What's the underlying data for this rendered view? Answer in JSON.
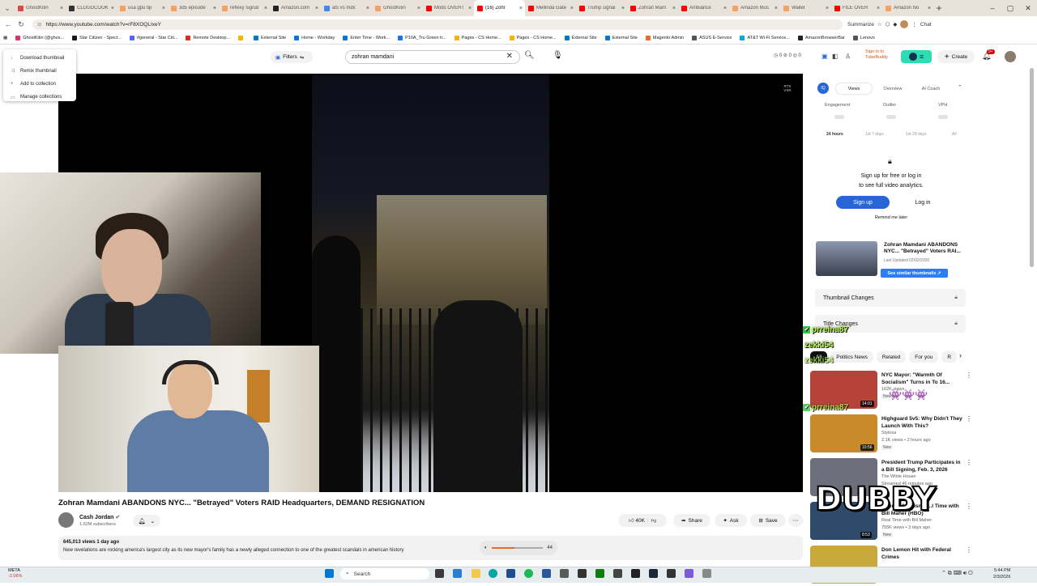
{
  "browser": {
    "tabs": [
      {
        "label": "GhostKitin",
        "color": "#d84a4a"
      },
      {
        "label": "CLOUDCOOK",
        "color": "#333333"
      },
      {
        "label": "usa gpu tip",
        "color": "#f4a261"
      },
      {
        "label": "3d5 episode",
        "color": "#f4a261"
      },
      {
        "label": "reflexy signal",
        "color": "#f4a261"
      },
      {
        "label": "Amazon.com",
        "color": "#222222"
      },
      {
        "label": "ats vs mdx",
        "color": "#4285f4"
      },
      {
        "label": "GhostKitin",
        "color": "#f4a261"
      },
      {
        "label": "Mobs OVERT",
        "color": "#ff0000"
      },
      {
        "label": "(16) Zohr",
        "color": "#ff0000"
      },
      {
        "label": "Mellinda Gate",
        "color": "#ff0000"
      },
      {
        "label": "Trump signal",
        "color": "#ff0000"
      },
      {
        "label": "Zohran Mam",
        "color": "#ff0000"
      },
      {
        "label": "Ambiance",
        "color": "#ff0000"
      },
      {
        "label": "Amazon Mus",
        "color": "#f4a261"
      },
      {
        "label": "Wallet",
        "color": "#f4a261"
      },
      {
        "label": "FILE OVER",
        "color": "#ff0000"
      },
      {
        "label": "Amazon No",
        "color": "#f4a261"
      }
    ],
    "active_tab_index": 9,
    "new_tab": "+",
    "url": "https://www.youtube.com/watch?v=rF8XOQLIxeY",
    "summarize": "Summarize",
    "chat_label": "Chat",
    "bookmarks": [
      {
        "label": "GhostKitin (@ghos...",
        "color": "#e1306c"
      },
      {
        "label": "Star Citizen - Spect...",
        "color": "#1a1a1a"
      },
      {
        "label": "#general - Star Citi...",
        "color": "#5865f2"
      },
      {
        "label": "Remote Desktop...",
        "color": "#d93025"
      },
      {
        "label": "",
        "color": "#f4b400"
      },
      {
        "label": "External Site",
        "color": "#0078d4"
      },
      {
        "label": "Home - Workday",
        "color": "#0875e1"
      },
      {
        "label": "Enter Time - Work...",
        "color": "#0875e1"
      },
      {
        "label": "P10A_Tru Green tr...",
        "color": "#1a73e8"
      },
      {
        "label": "Pages - CS Home...",
        "color": "#f4b400"
      },
      {
        "label": "Pages - CS Home...",
        "color": "#f4b400"
      },
      {
        "label": "External Site",
        "color": "#0078d4"
      },
      {
        "label": "External Site",
        "color": "#0078d4"
      },
      {
        "label": "Magento Admin",
        "color": "#ee672f"
      },
      {
        "label": "ASUS E-Service",
        "color": "#555555"
      },
      {
        "label": "AT&T Wi-Fi Service...",
        "color": "#00a8e0"
      },
      {
        "label": "AmazonBrowserBar",
        "color": "#222222"
      },
      {
        "label": "Lenovo",
        "color": "#555555"
      }
    ]
  },
  "context_menu": {
    "items": [
      {
        "label": "Download thumbnail",
        "icon": "↓"
      },
      {
        "label": "Remix thumbnail",
        "icon": "⤨"
      },
      {
        "label": "Add to collection",
        "icon": "+"
      },
      {
        "label": "Manage collections",
        "icon": "▭"
      }
    ]
  },
  "youtube": {
    "filters_label": "Filters",
    "search_value": "zohran mamdani",
    "header_counts": "◷ 0  ⊘ 0  ◎ 0",
    "tubebuddy_signin": "Sign in to TubeBuddy",
    "create_label": "Create",
    "notif_badge": "9+",
    "video_badge": "RTX VSR",
    "video_title": "Zohran Mamdani ABANDONS NYC... \"Betrayed\" Voters RAID Headquarters, DEMAND RESIGNATION",
    "channel_name": "Cash Jordan",
    "channel_subs": "1.62M subscribers",
    "likes": "40K",
    "share_label": "Share",
    "ask_label": "Ask",
    "save_label": "Save",
    "views_date": "645,013 views  1 day ago",
    "description": "New revelations are rocking america's largest city as its new mayor's family has a newly alleged connection to one of the greatest scandals in american history",
    "volume_value": 44,
    "volume_label": "44"
  },
  "vidiq": {
    "tabs": [
      "Views",
      "Overview",
      "AI Coach"
    ],
    "metrics": [
      "Engagement",
      "Outlier",
      "VPH"
    ],
    "ranges": [
      "24 hours",
      "1st 7 days",
      "1st 28 days",
      "All"
    ],
    "lock_msg_1": "Sign up for free or log in",
    "lock_msg_2": "to see full video analytics.",
    "signup_label": "Sign up",
    "login_label": "Log in",
    "remind_label": "Remind me later",
    "similar": {
      "title": "Zohran Mamdani ABANDONS NYC... \"Betrayed\" Voters RAI...",
      "date": "Last Updated 02/02/2026",
      "button": "See similar thumbnails  ↗"
    },
    "thumbnail_changes": "Thumbnail Changes",
    "title_changes": "Title Changes"
  },
  "related": {
    "chips": [
      "All",
      "Politics News",
      "Related",
      "For you",
      "R"
    ],
    "videos": [
      {
        "title": "NYC Mayor: \"Warmth Of Socialism\" Turns in To 16...",
        "channel": "",
        "meta": "162K views",
        "badge": "New",
        "duration": "14:01",
        "thumb": "#b5433a"
      },
      {
        "title": "Highguard 5v5: Why Didn't They Launch With This?",
        "channel": "Stylosa",
        "meta": "2.1K views • 2 hours ago",
        "badge": "New",
        "duration": "10:56",
        "thumb": "#c98b2a"
      },
      {
        "title": "President Trump Participates in a Bill Signing, Feb. 3, 2026",
        "channel": "The White House",
        "meta": "Streamed 46 minutes ago",
        "badge": "",
        "duration": "",
        "thumb": "#6d6f7a"
      },
      {
        "title": "...yeroll Activism | ...l Time with Bill Maher (HBO)",
        "channel": "Real Time with Bill Maher",
        "meta": "755K views • 3 days ago",
        "badge": "New",
        "duration": "8:53",
        "thumb": "#2f4a6b"
      },
      {
        "title": "Don Lemon Hit with Federal Crimes",
        "channel": "",
        "meta": "",
        "badge": "",
        "duration": "",
        "thumb": "#c8a83a"
      }
    ]
  },
  "stream_overlay": {
    "chatters": [
      "prreina87",
      "zekki54",
      "zekki54",
      "prreina87"
    ],
    "brand": "DUBBY"
  },
  "taskbar": {
    "ticker_name": "META",
    "ticker_change": "-2.06%",
    "search_placeholder": "Search",
    "time": "5:44 PM",
    "date": "2/3/2026"
  }
}
